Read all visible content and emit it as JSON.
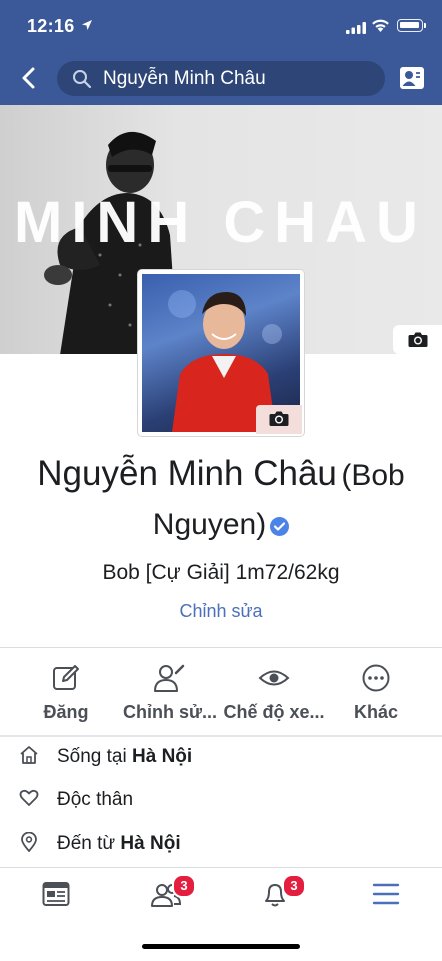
{
  "status": {
    "time": "12:16"
  },
  "search": {
    "query": "Nguyễn Minh Châu"
  },
  "cover": {
    "text": "MINH CHAU"
  },
  "profile": {
    "name": "Nguyễn Minh Châu",
    "alt_name_line1": "(Bob",
    "alt_name_line2": "Nguyen)",
    "bio": "Bob [Cự Giải] 1m72/62kg",
    "edit_label": "Chỉnh sửa"
  },
  "actions": [
    {
      "label": "Đăng",
      "icon": "compose-icon"
    },
    {
      "label": "Chỉnh sử...",
      "icon": "edit-profile-icon"
    },
    {
      "label": "Chế độ xe...",
      "icon": "eye-icon"
    },
    {
      "label": "Khác",
      "icon": "more-icon"
    }
  ],
  "about": {
    "lives_prefix": "Sống tại ",
    "lives_place": "Hà Nội",
    "relationship": "Độc thân",
    "from_prefix": "Đến từ ",
    "from_place": "Hà Nội"
  },
  "tabs": {
    "friends_badge": "3",
    "notifications_badge": "3"
  },
  "colors": {
    "brand": "#3b5998",
    "accent": "#4b6fbb",
    "badge": "#e41e3f"
  }
}
